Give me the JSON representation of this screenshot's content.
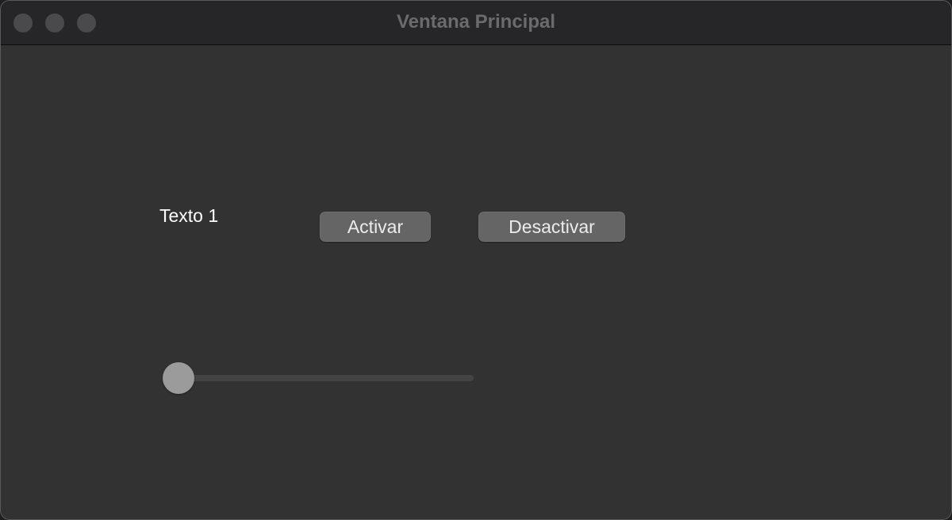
{
  "window": {
    "title": "Ventana Principal"
  },
  "main": {
    "label_text": "Texto 1",
    "activate_label": "Activar",
    "deactivate_label": "Desactivar",
    "slider": {
      "value": 0,
      "min": 0,
      "max": 100
    }
  },
  "colors": {
    "window_bg": "#323232",
    "titlebar_bg": "#262628",
    "button_bg": "#656565",
    "slider_knob": "#9b9b9b",
    "slider_track": "#444444"
  }
}
